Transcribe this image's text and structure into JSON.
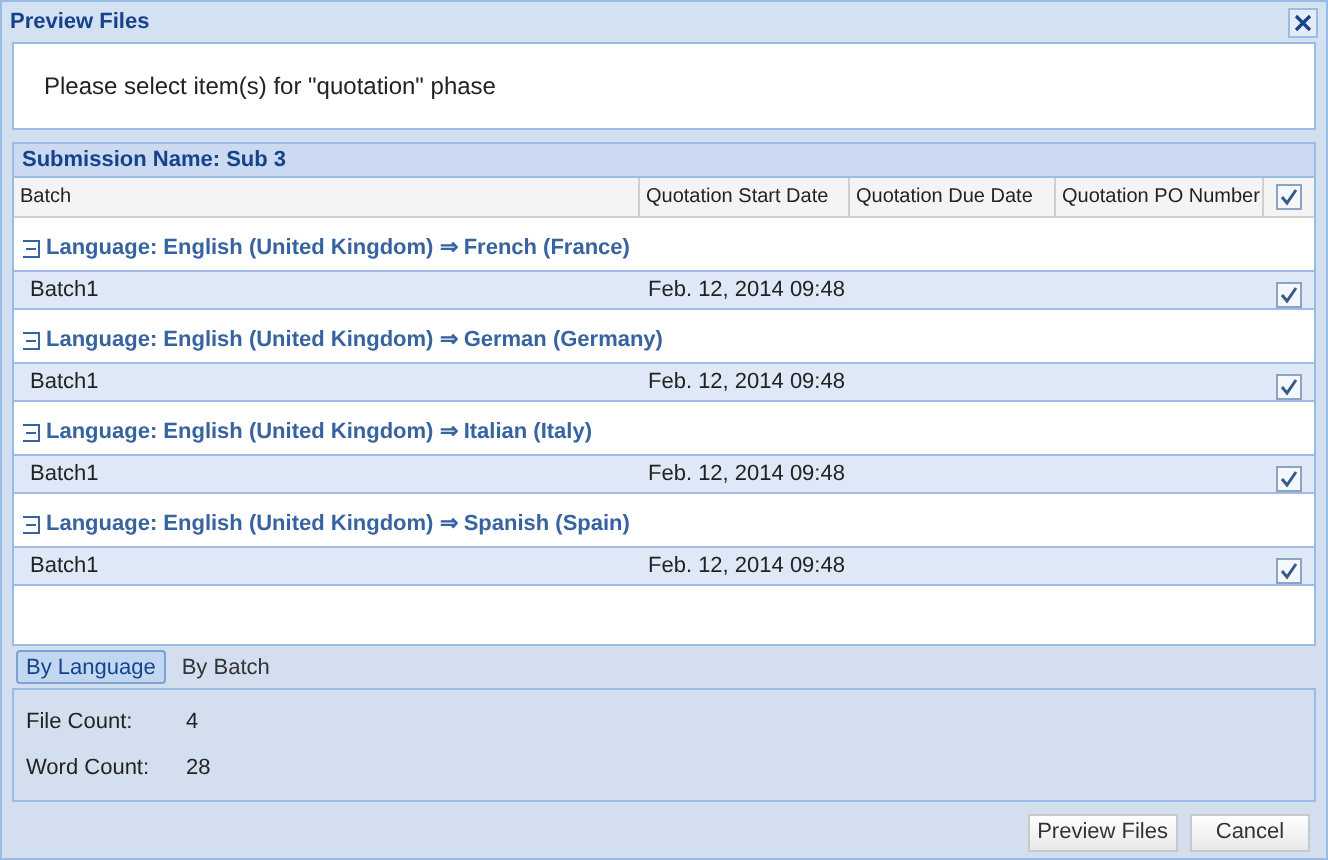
{
  "window": {
    "title": "Preview Files"
  },
  "instruction": "Please select item(s) for \"quotation\" phase",
  "grid": {
    "title": "Submission Name: Sub 3",
    "columns": [
      "Batch",
      "Quotation Start Date",
      "Quotation Due Date",
      "Quotation PO Number"
    ],
    "header_checked": true,
    "groups": [
      {
        "label": "Language: English (United Kingdom) ⇒ French (France)",
        "expanded": true,
        "rows": [
          {
            "batch": "Batch1",
            "start": "Feb. 12, 2014 09:48",
            "checked": true
          }
        ]
      },
      {
        "label": "Language: English (United Kingdom) ⇒ German (Germany)",
        "expanded": true,
        "rows": [
          {
            "batch": "Batch1",
            "start": "Feb. 12, 2014 09:48",
            "checked": true
          }
        ]
      },
      {
        "label": "Language: English (United Kingdom) ⇒ Italian (Italy)",
        "expanded": true,
        "rows": [
          {
            "batch": "Batch1",
            "start": "Feb. 12, 2014 09:48",
            "checked": true
          }
        ]
      },
      {
        "label": "Language: English (United Kingdom) ⇒ Spanish (Spain)",
        "expanded": true,
        "rows": [
          {
            "batch": "Batch1",
            "start": "Feb. 12, 2014 09:48",
            "checked": true
          }
        ]
      }
    ]
  },
  "tabs": [
    {
      "label": "By Language",
      "selected": true
    },
    {
      "label": "By Batch",
      "selected": false
    }
  ],
  "counts": [
    {
      "label": "File Count:",
      "value": "4"
    },
    {
      "label": "Word Count:",
      "value": "28"
    }
  ],
  "buttons": [
    "Preview Files",
    "Cancel"
  ]
}
